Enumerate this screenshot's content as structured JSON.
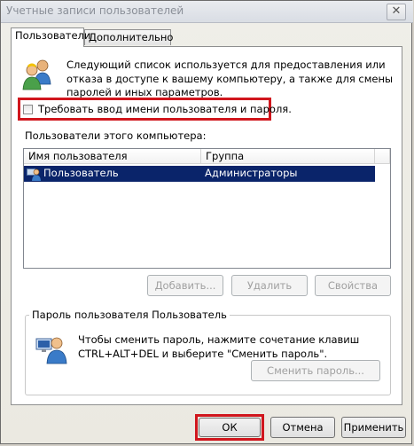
{
  "window": {
    "title": "Учетные записи пользователей",
    "close_glyph": "✕"
  },
  "tabs": [
    {
      "label": "Пользователи",
      "active": true
    },
    {
      "label": "Дополнительно",
      "active": false
    }
  ],
  "intro_text": "Следующий список используется для предоставления или отказа в доступе к вашему компьютеру, а также для смены паролей и иных параметров.",
  "require_login": {
    "label": "Требовать ввод имени пользователя и пароля.",
    "checked": false,
    "highlight_color": "#d0161d"
  },
  "users_list": {
    "label": "Пользователи этого компьютера:",
    "columns": [
      "Имя пользователя",
      "Группа"
    ],
    "rows": [
      {
        "name": "Пользователь",
        "group": "Администраторы",
        "selected": true
      }
    ],
    "selection_color": "#0a246a"
  },
  "list_buttons": {
    "add": "Добавить...",
    "remove": "Удалить",
    "properties": "Свойства"
  },
  "password_group": {
    "title": "Пароль пользователя Пользователь",
    "text": "Чтобы сменить пароль, нажмите сочетание клавиш CTRL+ALT+DEL и выберите \"Сменить пароль\".",
    "button": "Сменить пароль..."
  },
  "dialog_buttons": {
    "ok": "ОК",
    "cancel": "Отмена",
    "apply": "Применить"
  },
  "icons": {
    "users": "users-icon",
    "row_user": "user-row-icon",
    "password": "password-user-icon"
  }
}
